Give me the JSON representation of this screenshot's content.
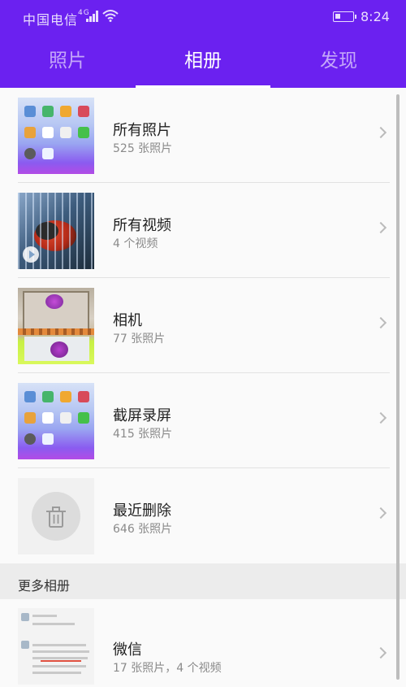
{
  "status_bar": {
    "carrier": "中国电信",
    "network": "4G",
    "time": "8:24"
  },
  "tabs": [
    {
      "label": "照片",
      "active": false
    },
    {
      "label": "相册",
      "active": true
    },
    {
      "label": "发现",
      "active": false
    }
  ],
  "albums": [
    {
      "title": "所有照片",
      "subtitle": "525 张照片",
      "thumb": "phone-screenshot"
    },
    {
      "title": "所有视频",
      "subtitle": "4 个视频",
      "thumb": "video-bird"
    },
    {
      "title": "相机",
      "subtitle": "77 张照片",
      "thumb": "camera-flowers"
    },
    {
      "title": "截屏录屏",
      "subtitle": "415 张照片",
      "thumb": "phone-screenshot"
    },
    {
      "title": "最近删除",
      "subtitle": "646 张照片",
      "thumb": "trash-icon"
    }
  ],
  "more_section": {
    "title": "更多相册",
    "albums": [
      {
        "title": "微信",
        "subtitle": "17 张照片，4 个视频",
        "thumb": "wechat-chat"
      }
    ]
  },
  "colors": {
    "header_bg": "#6b21f0",
    "background": "#fafafa",
    "section_bg": "#ececec"
  }
}
